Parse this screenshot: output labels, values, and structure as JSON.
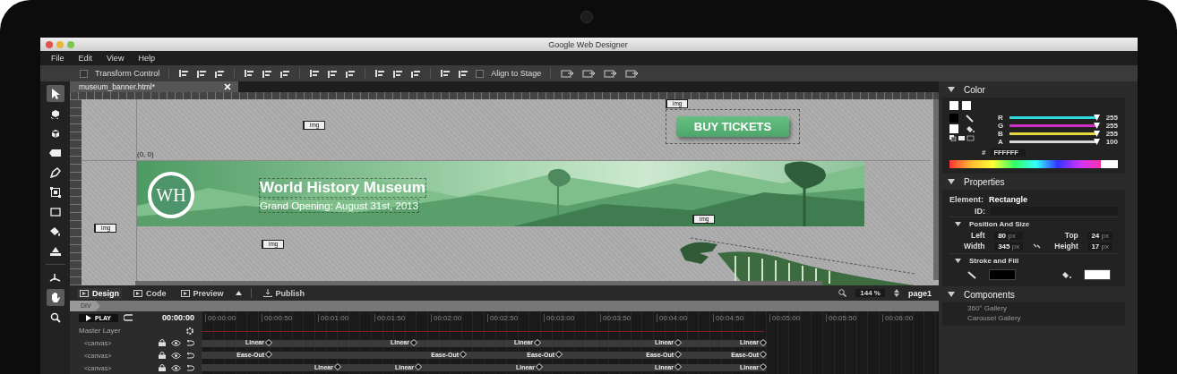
{
  "window": {
    "title": "Google Web Designer"
  },
  "menu": [
    "File",
    "Edit",
    "View",
    "Help"
  ],
  "toolbar": {
    "transform_control": {
      "label": "Transform Control",
      "checked": false
    },
    "align_to_stage": {
      "label": "Align to Stage",
      "checked": false
    }
  },
  "document_tab": {
    "title": "museum_banner.html*"
  },
  "tools": [
    {
      "kind": "select",
      "selected": true
    },
    {
      "kind": "rotate3d",
      "selected": false
    },
    {
      "kind": "object3d",
      "selected": false
    },
    {
      "kind": "tag",
      "selected": false
    },
    {
      "kind": "pen",
      "selected": false
    },
    {
      "kind": "transform",
      "selected": false
    },
    {
      "kind": "shape",
      "selected": false
    },
    {
      "kind": "fill",
      "selected": false
    },
    {
      "kind": "stroke",
      "selected": false
    },
    {
      "kind": "translate3d",
      "selected": false
    },
    {
      "kind": "hand",
      "selected": true
    },
    {
      "kind": "zoom",
      "selected": false
    }
  ],
  "stage": {
    "origin_label": "(0, 0)",
    "img_tags": [
      "img",
      "img",
      "img",
      "img",
      "img"
    ],
    "banner": {
      "logo": "WH",
      "title": "World History Museum",
      "subtitle": "Grand Opening: August 31st, 2013"
    },
    "cta_button": "BUY TICKETS"
  },
  "view_bar": {
    "modes": [
      {
        "label": "Design",
        "selected": true
      },
      {
        "label": "Code",
        "selected": false
      },
      {
        "label": "Preview",
        "selected": false
      }
    ],
    "publish": "Publish",
    "zoom": "144 %",
    "page": "page1"
  },
  "breadcrumb": "DIV",
  "timeline": {
    "play": "PLAY",
    "current_time": "00:00:00",
    "times": [
      "00:00:00",
      "00:00:50",
      "00:01:00",
      "00:01:50",
      "00:02:00",
      "00:02:50",
      "00:03:00",
      "00:03:50",
      "00:04:00",
      "00:04:50",
      "00:05:00",
      "00:05:50",
      "00:06:00"
    ],
    "master_layer": "Master Layer",
    "layers": [
      {
        "name": "<canvas>",
        "keyframes": [
          "Linear",
          "Linear",
          "Linear",
          "Linear",
          "Linear"
        ]
      },
      {
        "name": "<canvas>",
        "keyframes": [
          "Ease-Out",
          "Ease-Out",
          "Ease-Out",
          "Ease-Out",
          "Ease-Out"
        ]
      },
      {
        "name": "<canvas>",
        "keyframes": [
          "Linear",
          "Linear",
          "Linear",
          "Linear",
          "Linear"
        ]
      }
    ]
  },
  "color_panel": {
    "title": "Color",
    "channels": [
      {
        "name": "R",
        "level": 1,
        "reading": "255",
        "color": "#30d8e0"
      },
      {
        "name": "G",
        "level": 1,
        "reading": "255",
        "color": "#d030c8"
      },
      {
        "name": "B",
        "level": 1,
        "reading": "255",
        "color": "#e8d840"
      },
      {
        "name": "A",
        "level": 1,
        "reading": "100",
        "color": "#d8d8d8"
      }
    ],
    "hash": "#",
    "hex": "FFFFFF"
  },
  "properties": {
    "title": "Properties",
    "element_label": "Element:",
    "element": "Rectangle",
    "id_label": "ID:",
    "position_title": "Position And Size",
    "fields": [
      {
        "label": "Left",
        "value": "80",
        "unit": "px"
      },
      {
        "label": "Top",
        "value": "24",
        "unit": "px"
      },
      {
        "label": "Width",
        "value": "345",
        "unit": "px"
      },
      {
        "label": "Height",
        "value": "17",
        "unit": "px"
      }
    ],
    "stroke_fill_title": "Stroke and Fill"
  },
  "components": {
    "title": "Components",
    "items": [
      "360° Gallery",
      "Carousel Gallery"
    ]
  }
}
